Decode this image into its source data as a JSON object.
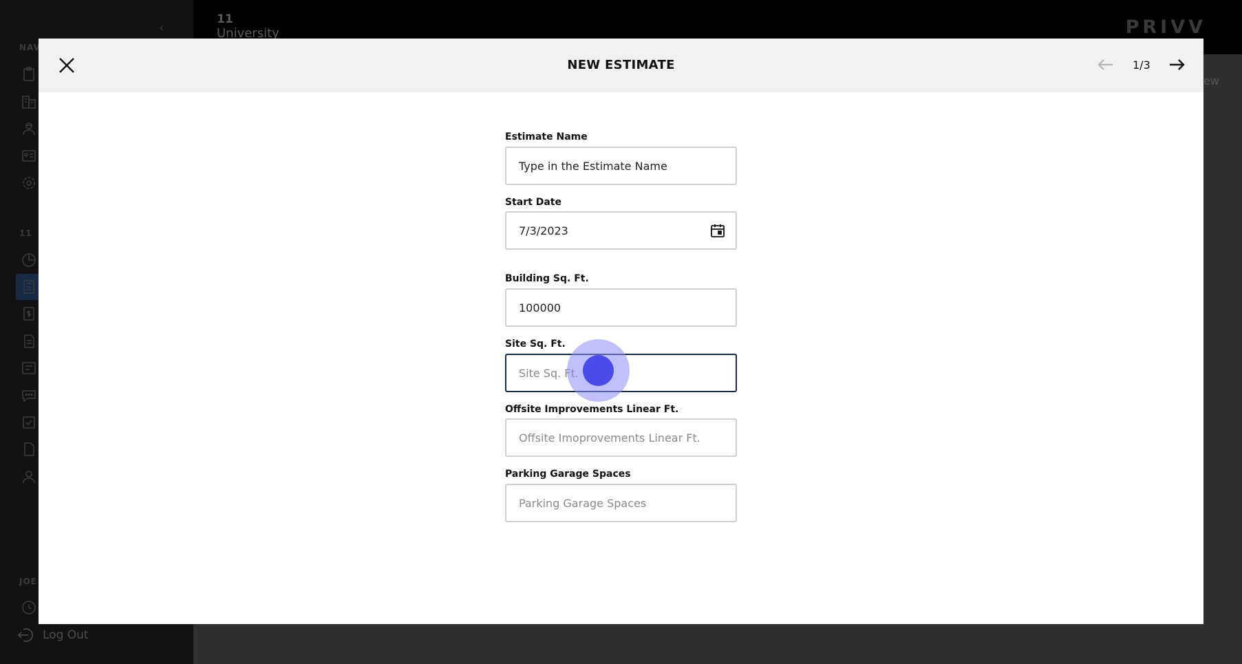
{
  "background": {
    "sidebar": {
      "section_labels": [
        "NAV",
        "11",
        "JOE"
      ],
      "logout_label": "Log Out"
    },
    "topbar": {
      "project_number": "11",
      "project_name": "University",
      "brand": "PRIVV"
    },
    "partial_link": "ew"
  },
  "modal": {
    "title": "NEW ESTIMATE",
    "page_indicator": "1/3",
    "fields": {
      "estimate_name": {
        "label": "Estimate Name",
        "value": "Type in the Estimate Name",
        "placeholder": "Type in the Estimate Name"
      },
      "start_date": {
        "label": "Start Date",
        "value": "7/3/2023"
      },
      "building_sqft": {
        "label": "Building Sq. Ft.",
        "value": "100000"
      },
      "site_sqft": {
        "label": "Site Sq. Ft.",
        "value": "",
        "placeholder": "Site Sq. Ft."
      },
      "offsite_linear_ft": {
        "label": "Offsite Improvements Linear Ft.",
        "value": "",
        "placeholder": "Offsite Imoprovements Linear Ft."
      },
      "parking_spaces": {
        "label": "Parking Garage Spaces",
        "value": "",
        "placeholder": "Parking Garage Spaces"
      }
    }
  },
  "colors": {
    "focus_border": "#172a45",
    "click_indicator": "#4b4bea"
  }
}
